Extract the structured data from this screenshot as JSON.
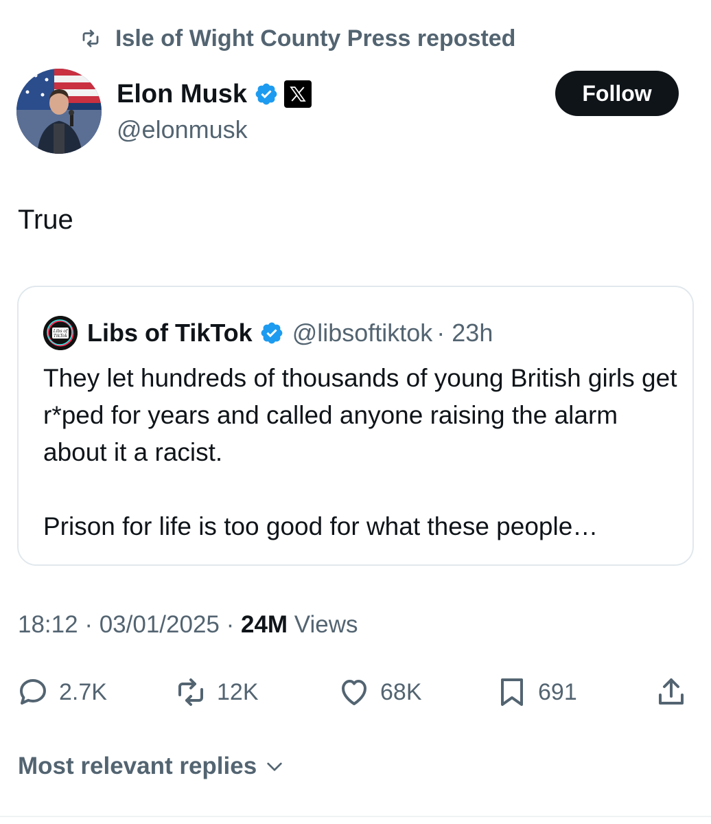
{
  "repost": {
    "label": "Isle of Wight County Press reposted",
    "icon": "repost-icon"
  },
  "author": {
    "name": "Elon Musk",
    "handle": "@elonmusk",
    "verified_icon": "verified-badge-icon",
    "affiliate_icon": "x-logo-icon"
  },
  "follow_button": {
    "label": "Follow"
  },
  "tweet": {
    "text": "True"
  },
  "quoted_tweet": {
    "name": "Libs of TikTok",
    "handle": "@libsoftiktok",
    "time": "· 23h",
    "paragraph_1": "They let hundreds of thousands of young British girls get r*ped for years and called anyone raising the alarm about it a racist.",
    "paragraph_2": "Prison for life is too good for what these people…"
  },
  "meta": {
    "time": "18:12",
    "separator": " · ",
    "date": "03/01/2025",
    "views_count": "24M",
    "views_label": " Views"
  },
  "actions": {
    "replies": "2.7K",
    "reposts": "12K",
    "likes": "68K",
    "bookmarks": "691"
  },
  "replies_sort": {
    "label": "Most relevant replies"
  },
  "colors": {
    "text_primary": "#0f1419",
    "text_secondary": "#536471",
    "verified_blue": "#1d9bf0",
    "border": "#e1e8ed"
  }
}
